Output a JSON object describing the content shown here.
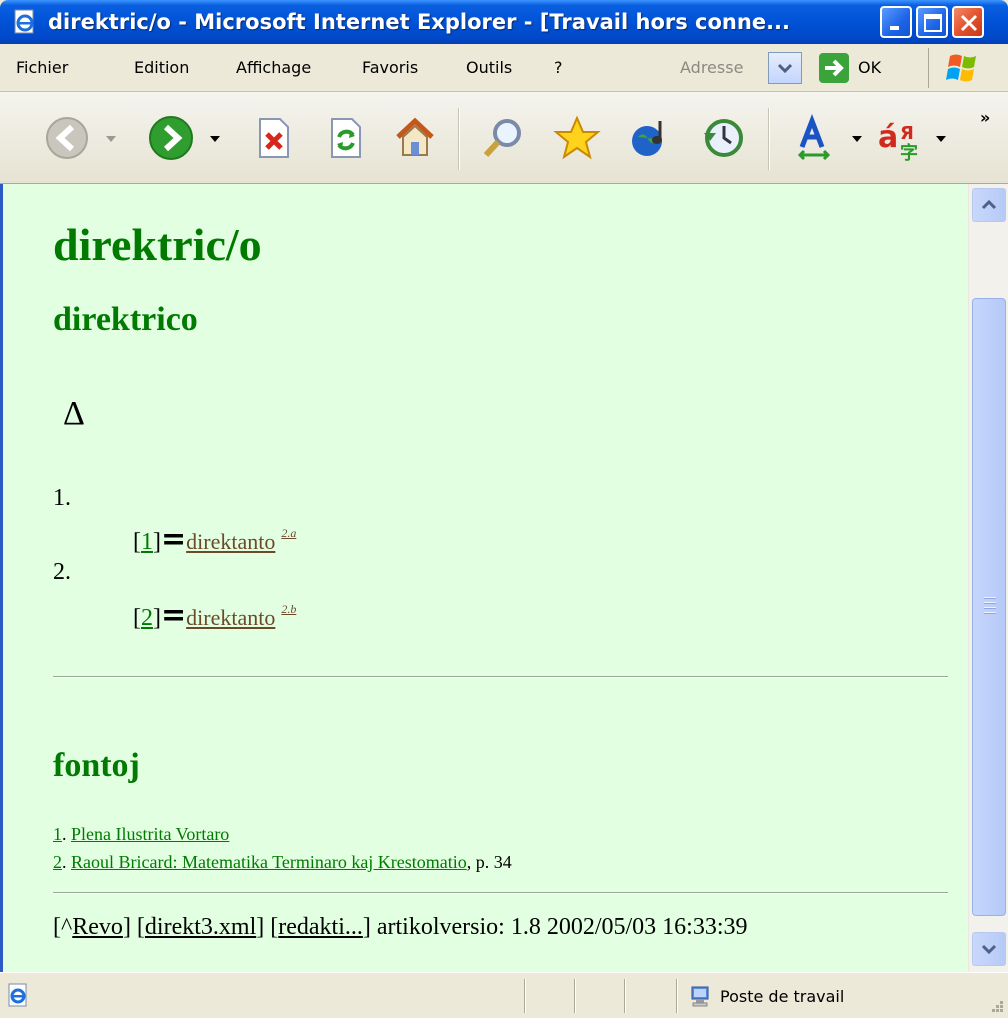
{
  "window": {
    "title": "direktric/o - Microsoft Internet Explorer - [Travail hors conne..."
  },
  "menu": {
    "items": [
      "Fichier",
      "Edition",
      "Affichage",
      "Favoris",
      "Outils",
      "?"
    ],
    "address_label": "Adresse",
    "go_label": "OK"
  },
  "toolbar": {
    "icons": [
      "back-icon",
      "forward-icon",
      "stop-icon",
      "refresh-icon",
      "home-icon",
      "search-icon",
      "favorites-icon",
      "media-icon",
      "history-icon",
      "font-size-icon",
      "encoding-icon"
    ]
  },
  "page": {
    "title": "direktric/o",
    "subtitle": "direktrico",
    "symbol": "Δ",
    "definitions": [
      {
        "number": "1.",
        "ref_open": "[",
        "ref": "1",
        "ref_close": "]",
        "eq": "=",
        "link": "direktanto",
        "sup": "2.a"
      },
      {
        "number": "2.",
        "ref_open": "[",
        "ref": "2",
        "ref_close": "]",
        "eq": "=",
        "link": "direktanto",
        "sup": "2.b"
      }
    ],
    "sources_heading": "fontoj",
    "sources": [
      {
        "n": "1",
        "text": "Plena Ilustrita Vortaro",
        "suffix": ""
      },
      {
        "n": "2",
        "text": "Raoul Bricard: Matematika Terminaro kaj Krestomatio",
        "suffix": ", p. 34"
      }
    ],
    "footer": {
      "revo_pre": "[^",
      "revo": "Revo",
      "xml_pre": "] [",
      "xml": "direkt3.xml",
      "edit_pre": "] [",
      "edit": "redakti...",
      "version": "] artikolversio: 1.8 2002/05/03 16:33:39"
    }
  },
  "status": {
    "zone": "Poste de travail"
  }
}
